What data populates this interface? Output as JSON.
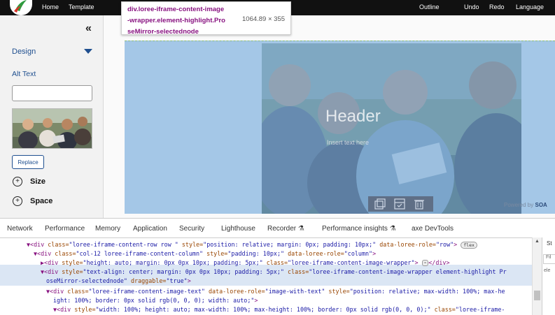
{
  "topbar": {
    "items": [
      {
        "label": "Home"
      },
      {
        "label": "Template"
      },
      {
        "label": "Outline"
      },
      {
        "label": "Undo"
      },
      {
        "label": "Redo"
      },
      {
        "label": "Language"
      }
    ]
  },
  "tooltip": {
    "selector_lines": [
      "div.loree-iframe-content-image",
      "-wrapper.element-highlight.Pro",
      "seMirror-selectednode"
    ],
    "dimensions": "1064.89 × 355"
  },
  "sidebar": {
    "collapse_glyph": "«",
    "design_label": "Design",
    "alt_text_label": "Alt Text",
    "alt_text_value": "",
    "replace_label": "Replace",
    "sections": [
      {
        "label": "Size"
      },
      {
        "label": "Space"
      }
    ]
  },
  "canvas": {
    "header_text": "Header",
    "sub_text": "Insert text here",
    "powered_prefix": "Powered by",
    "powered_brand": "SOA"
  },
  "devtools": {
    "tabs": [
      "Network",
      "Performance",
      "Memory",
      "Application",
      "Security",
      "Lighthouse",
      "Recorder",
      "Performance insights",
      "axe DevTools"
    ],
    "styles_tab": "St",
    "filter_placeholder": "Fil",
    "side_text": "ele",
    "lines": [
      {
        "tag_open": "▼<div ",
        "a1": "class=",
        "v1": "\"loree-iframe-content-row row \" ",
        "a2": "style=",
        "v2": "\"position: relative; margin: 0px; padding: 10px;\" ",
        "a3": "data-loree-role=",
        "v3": "\"row\"",
        "tag_close": ">",
        "badge": "flex"
      },
      {
        "tag_open": "▼<div ",
        "a1": "class=",
        "v1": "\"col-12 loree-iframe-content-column\" ",
        "a2": "style=",
        "v2": "\"padding: 10px;\" ",
        "a3": "data-loree-role=",
        "v3": "\"column\"",
        "tag_close": ">"
      },
      {
        "tag_open": "▶<div ",
        "a1": "style=",
        "v1": "\"height: auto; margin: 0px 0px 10px; padding: 5px;\" ",
        "a2": "class=",
        "v2": "\"loree-iframe-content-image-wrapper\"",
        "tag_close": ">",
        "ellipsis": "⋯",
        "end": "</div>"
      },
      {
        "tag_open": "▼<div ",
        "a1": "style=",
        "v1": "\"text-align: center; margin: 0px 0px 10px; padding: 5px;\" ",
        "a2": "class=",
        "v2": "\"loree-iframe-content-image-wrapper element-highlight Pr"
      },
      {
        "cont": "oseMirror-selectednode\" ",
        "a1": "draggable=",
        "v1": "\"true\"",
        "tag_close": ">"
      },
      {
        "tag_open": "▼<div ",
        "a1": "class=",
        "v1": "\"loree-iframe-content-image-text\" ",
        "a2": "data-loree-role=",
        "v2": "\"image-with-text\" ",
        "a3": "style=",
        "v3": "\"position: relative; max-width: 100%; max-he"
      },
      {
        "cont": "ight: 100%; border: 0px solid rgb(0, 0, 0); width: auto;\"",
        "tag_close": ">"
      },
      {
        "tag_open": "▼<div ",
        "a1": "style=",
        "v1": "\"width: 100%; height: auto; max-width: 100%; max-height: 100%; border: 0px solid rgb(0, 0, 0);\" ",
        "a2": "class=",
        "v2": "\"loree-iframe-"
      }
    ]
  }
}
